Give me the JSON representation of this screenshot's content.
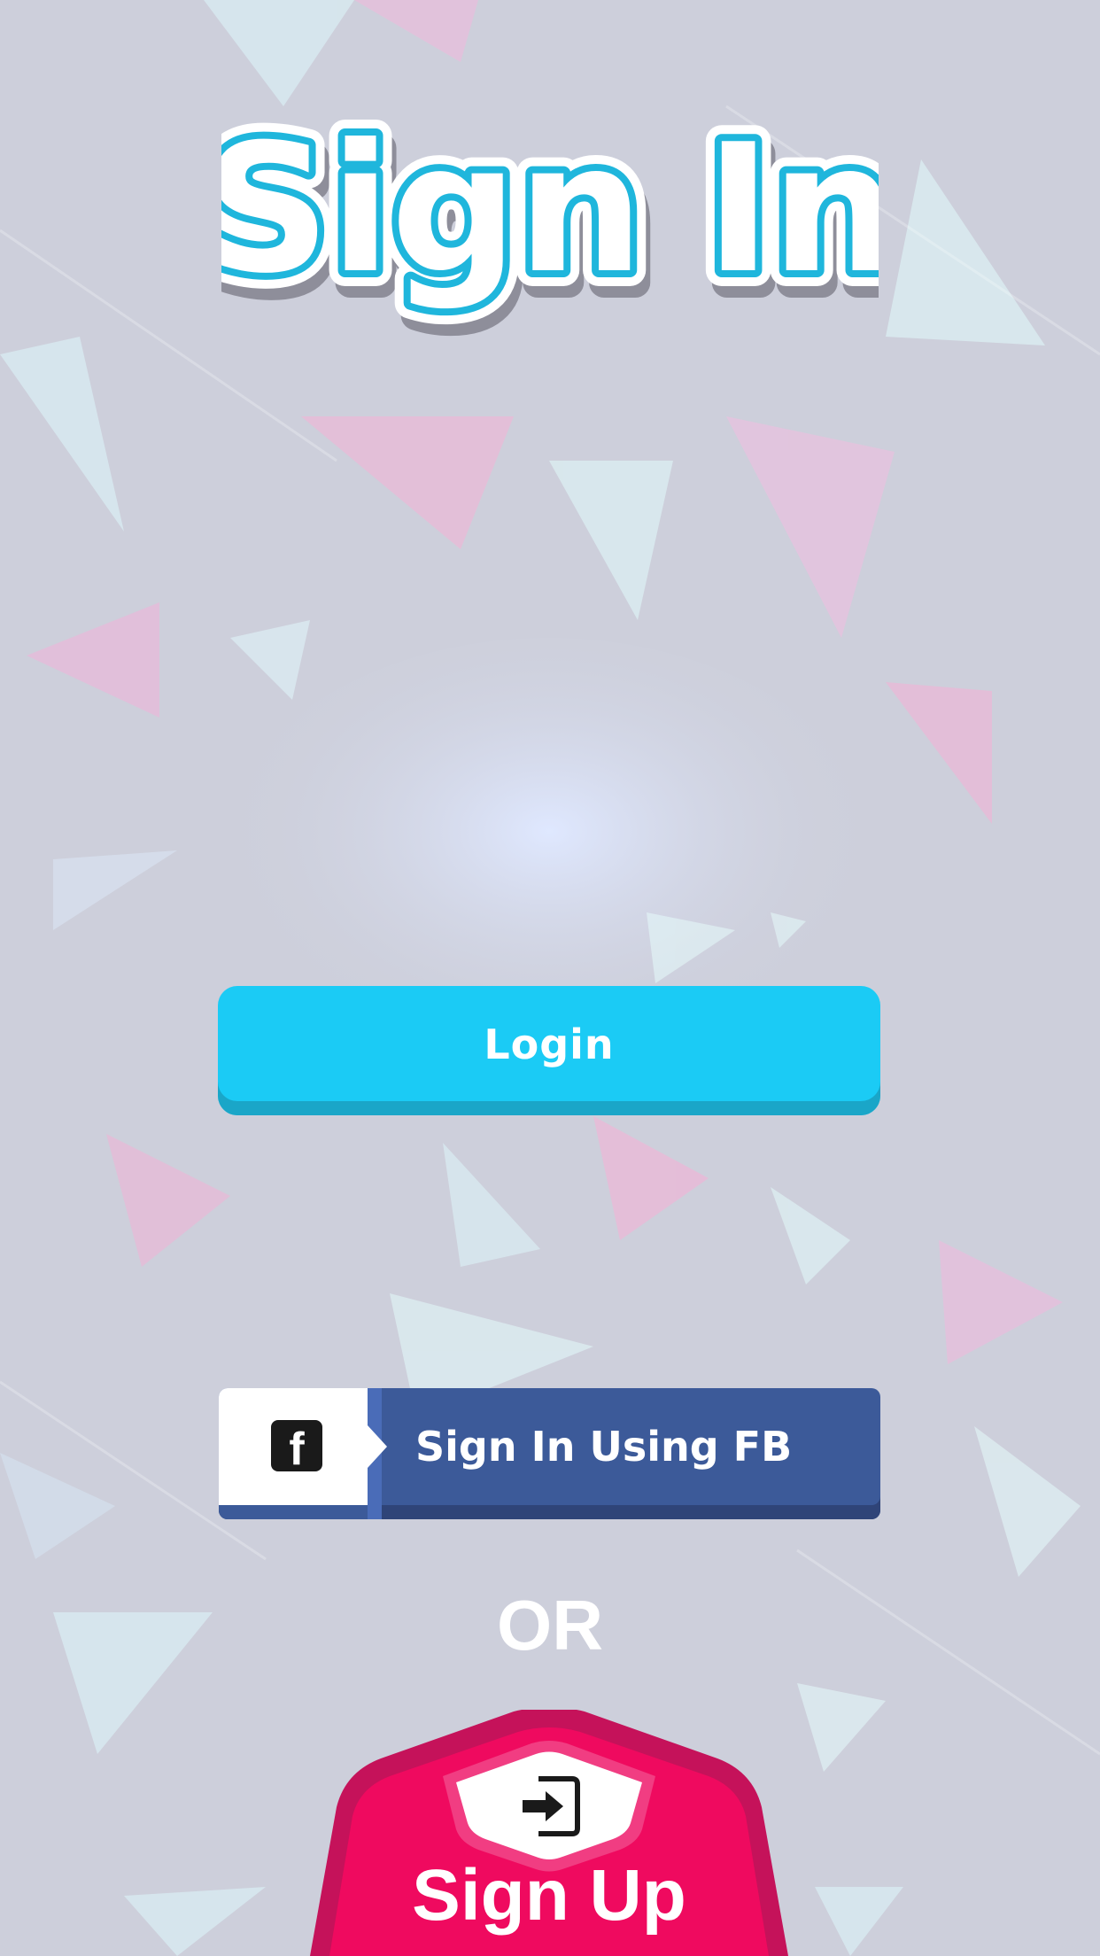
{
  "screen": {
    "title": "Sign In"
  },
  "actions": {
    "login_label": "Login",
    "facebook_label": "Sign In Using FB",
    "facebook_icon": "facebook-icon",
    "separator": "OR",
    "signup_label": "Sign Up",
    "signup_icon": "sign-in-arrow-icon"
  },
  "colors": {
    "login": "#1bcbf5",
    "facebook": "#3c5a99",
    "signup": "#ef0a5f",
    "title_outline": "#1fb6dc",
    "background": "#cdcfdb"
  }
}
